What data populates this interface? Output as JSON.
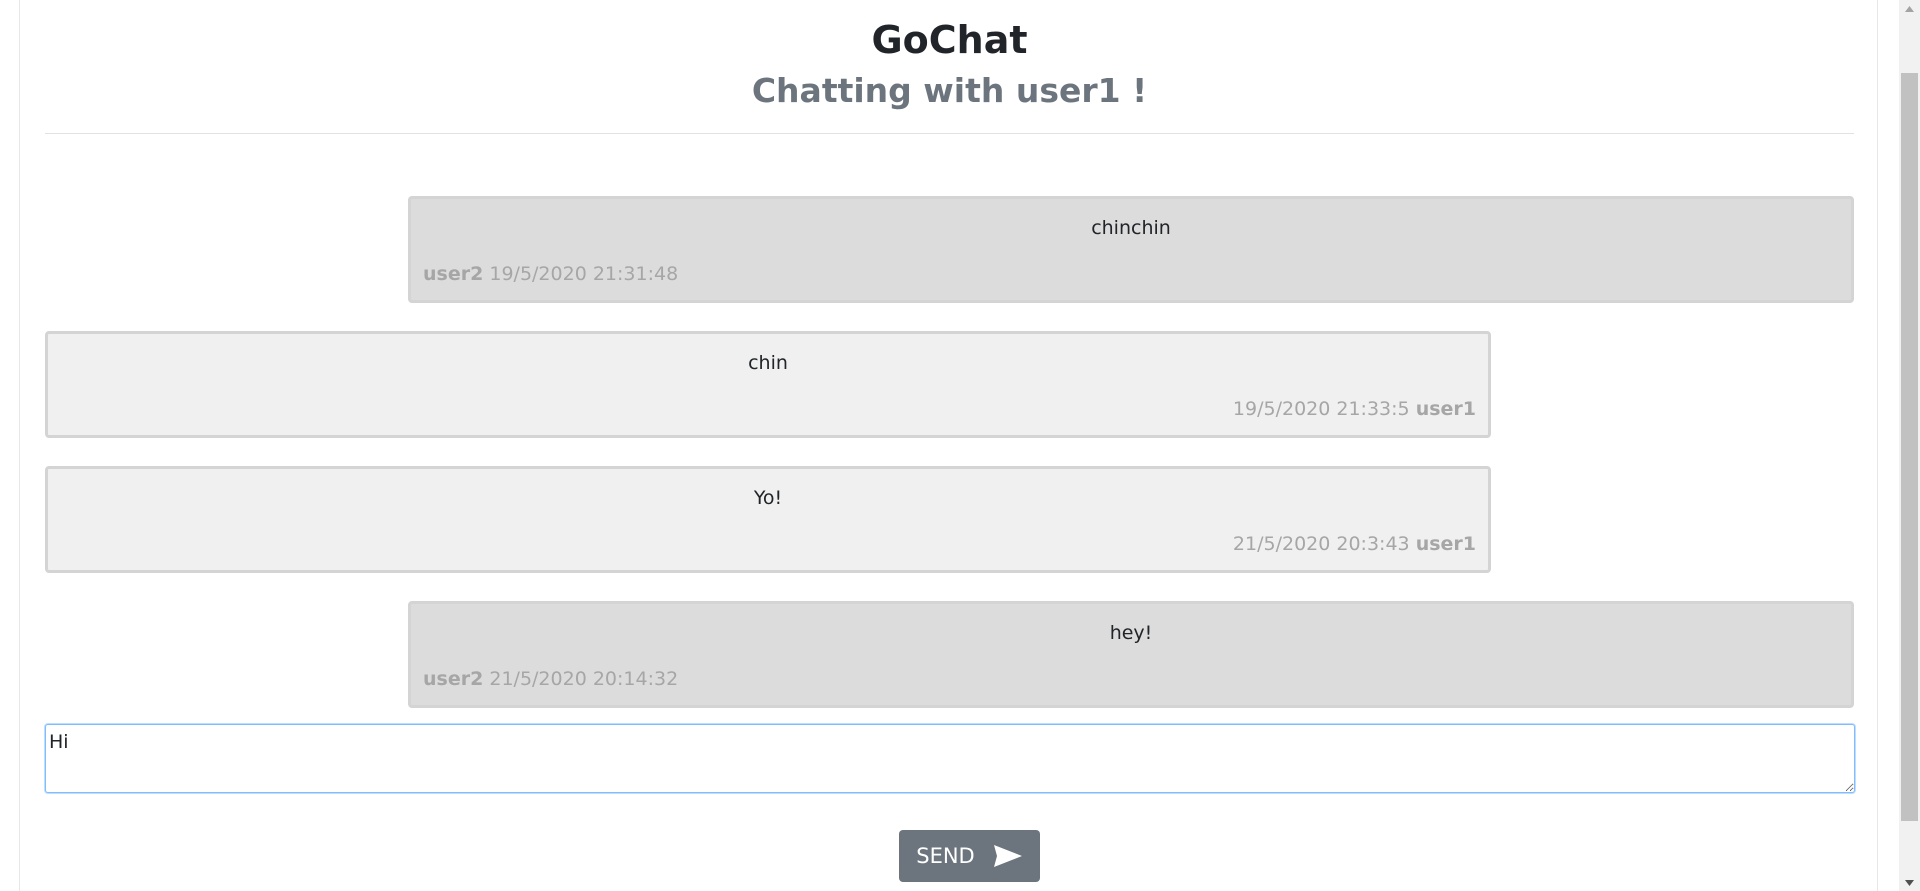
{
  "header": {
    "title": "GoChat",
    "subtitle": "Chatting with user1 !"
  },
  "messages": [
    {
      "direction": "sent",
      "text": "chinchin",
      "author": "user2",
      "timestamp": "19/5/2020 21:31:48"
    },
    {
      "direction": "received",
      "text": "chin",
      "author": "user1",
      "timestamp": "19/5/2020 21:33:5"
    },
    {
      "direction": "received",
      "text": "Yo!",
      "author": "user1",
      "timestamp": "21/5/2020 20:3:43"
    },
    {
      "direction": "sent",
      "text": "hey!",
      "author": "user2",
      "timestamp": "21/5/2020 20:14:32"
    }
  ],
  "composer": {
    "value": "Hi"
  },
  "send_button": {
    "label": "SEND",
    "icon": "send-icon"
  },
  "colors": {
    "title": "#212529",
    "subtitle": "#6c757d",
    "sent_bubble": "#dcdcdc",
    "received_bubble": "#f0f0f0",
    "meta_text": "#a6a6a6",
    "send_button": "#6c757d",
    "input_focus_border": "#80bdff"
  }
}
